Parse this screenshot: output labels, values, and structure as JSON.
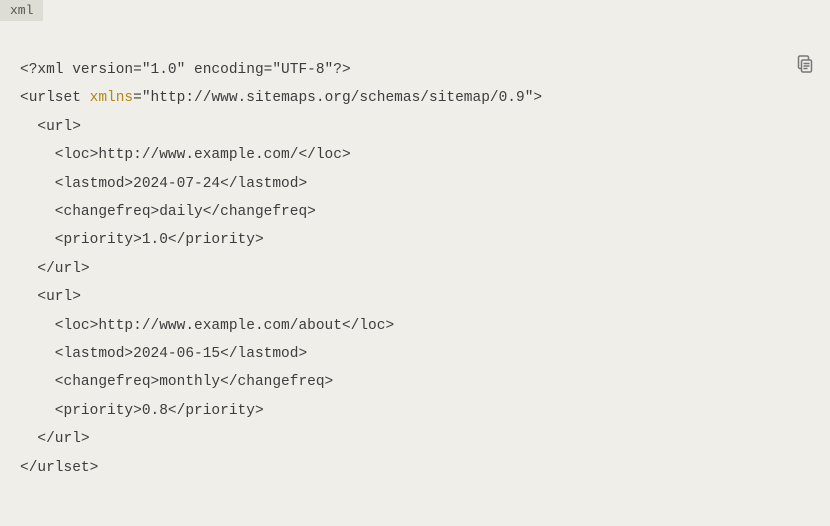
{
  "language_label": "xml",
  "code": {
    "xml_declaration": "<?xml version=\"1.0\" encoding=\"UTF-8\"?>",
    "urlset_open": "<urlset ",
    "xmlns_attr": "xmlns",
    "xmlns_value": "=\"http://www.sitemaps.org/schemas/sitemap/0.9\">",
    "url1_open": "  <url>",
    "url1_loc": "    <loc>http://www.example.com/</loc>",
    "url1_lastmod": "    <lastmod>2024-07-24</lastmod>",
    "url1_changefreq": "    <changefreq>daily</changefreq>",
    "url1_priority": "    <priority>1.0</priority>",
    "url1_close": "  </url>",
    "url2_open": "  <url>",
    "url2_loc": "    <loc>http://www.example.com/about</loc>",
    "url2_lastmod": "    <lastmod>2024-06-15</lastmod>",
    "url2_changefreq": "    <changefreq>monthly</changefreq>",
    "url2_priority": "    <priority>0.8</priority>",
    "url2_close": "  </url>",
    "urlset_close": "</urlset>"
  }
}
